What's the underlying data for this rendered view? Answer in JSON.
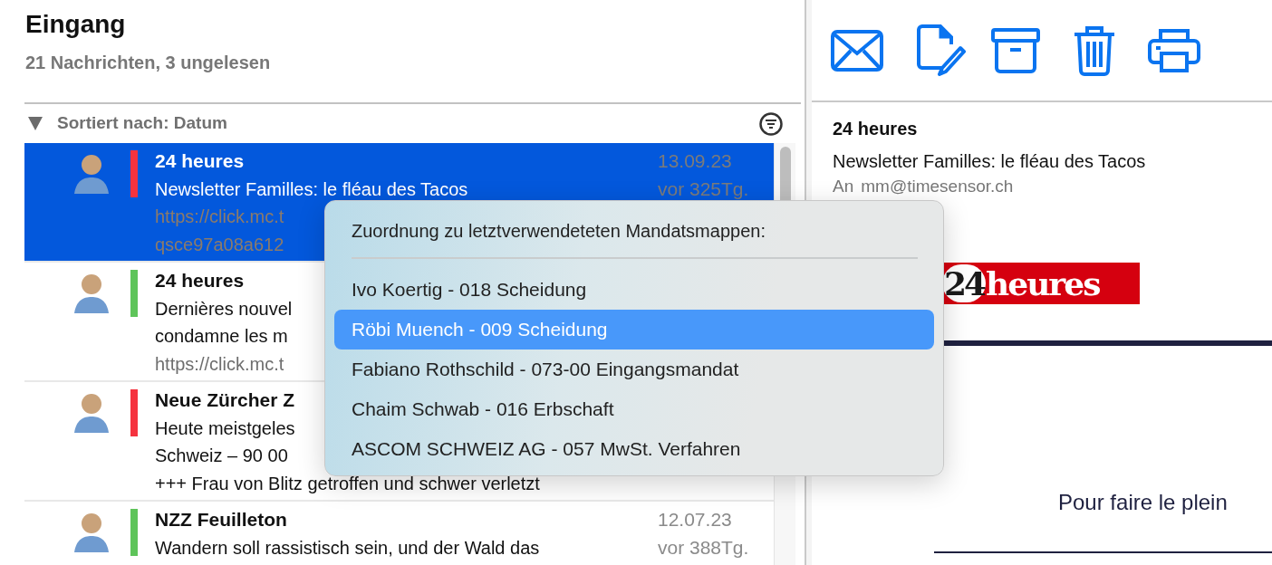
{
  "mailbox": {
    "title": "Eingang",
    "summary": "21 Nachrichten, 3 ungelesen"
  },
  "sort": {
    "label": "Sortiert nach: Datum",
    "expanded": true
  },
  "messages": [
    {
      "sender": "24 heures",
      "lines": [
        {
          "text": "Newsletter Familles: le fléau des Tacos",
          "kind": "text"
        },
        {
          "text": "https://click.mc.t",
          "kind": "link"
        },
        {
          "text": "qsce97a08a612",
          "kind": "link"
        }
      ],
      "date": "13.09.23",
      "age": "vor 325Tg.",
      "color": "#f5333f",
      "selected": true
    },
    {
      "sender": "24 heures",
      "lines": [
        {
          "text": "Dernières nouvel",
          "kind": "text"
        },
        {
          "text": "condamne les m",
          "kind": "text"
        },
        {
          "text": "https://click.mc.t",
          "kind": "link"
        }
      ],
      "color": "#5ec45a",
      "selected": false
    },
    {
      "sender": "Neue Zürcher Z",
      "lines": [
        {
          "text": "Heute meistgeles",
          "kind": "text"
        },
        {
          "text": "Schweiz – 90 00",
          "kind": "text"
        },
        {
          "text": "+++ Frau von Blitz getroffen und schwer verletzt",
          "kind": "text"
        }
      ],
      "color": "#f5333f",
      "selected": false
    },
    {
      "sender": "NZZ Feuilleton",
      "lines": [
        {
          "text": "Wandern soll rassistisch sein, und der Wald das",
          "kind": "text"
        }
      ],
      "date": "12.07.23",
      "age": "vor 388Tg.",
      "color": "#5ec45a",
      "selected": false
    }
  ],
  "preview": {
    "sender": "24 heures",
    "subject": "Newsletter Familles: le fléau des Tacos",
    "to_label": "An",
    "to": "mm@timesensor.ch",
    "logo": {
      "number": "24",
      "word": "heures"
    },
    "heading": "Pour faire le plein"
  },
  "context_menu": {
    "title": "Zuordnung zu letztverwendeteten Mandatsmappen:",
    "items": [
      {
        "label": "Ivo Koertig - 018 Scheidung",
        "selected": false
      },
      {
        "label": "Röbi Muench - 009 Scheidung",
        "selected": true
      },
      {
        "label": "Fabiano Rothschild - 073-00 Eingangsmandat",
        "selected": false
      },
      {
        "label": "Chaim Schwab - 016 Erbschaft",
        "selected": false
      },
      {
        "label": "ASCOM SCHWEIZ AG - 057 MwSt. Verfahren",
        "selected": false
      }
    ]
  }
}
